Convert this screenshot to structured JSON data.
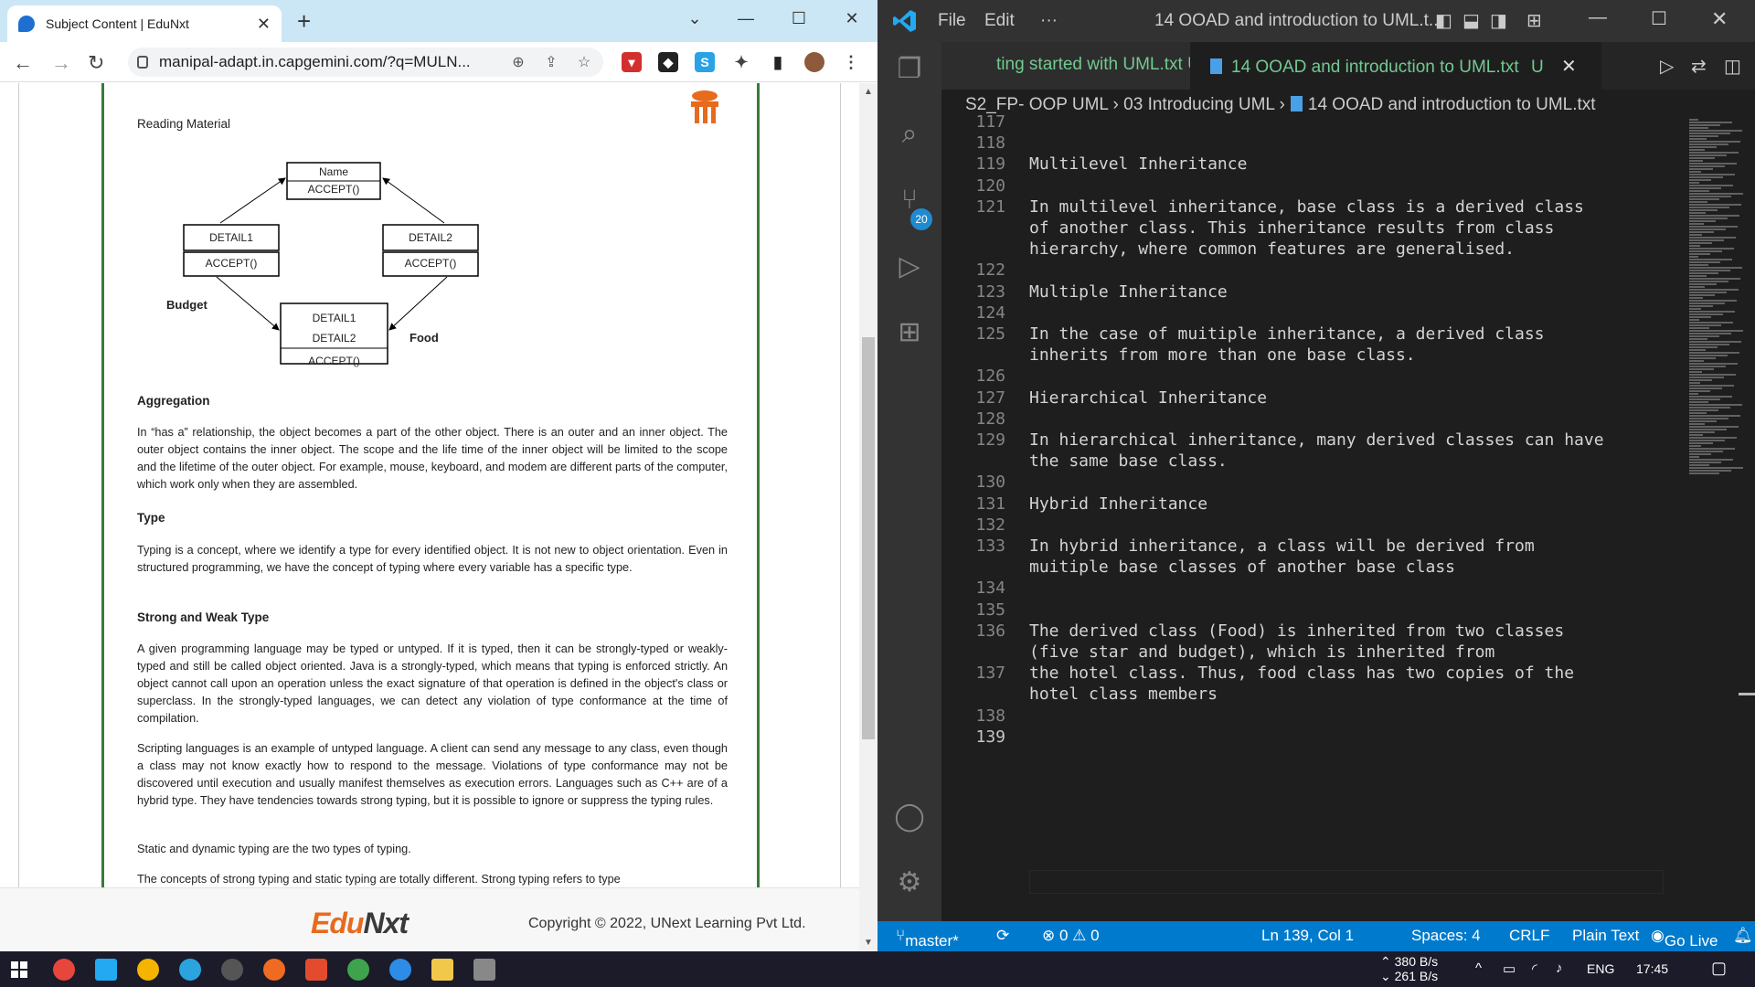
{
  "chrome": {
    "tab_title": "Subject Content | EduNxt",
    "url": "manipal-adapt.in.capgemini.com/?q=MULN...",
    "window_controls": {
      "minimize": "—",
      "maximize": "☐",
      "close": "✕",
      "dropdown": "⌄"
    }
  },
  "document": {
    "section_label": "Reading Material",
    "diagram": {
      "name_box": [
        "Name",
        "ACCEPT()"
      ],
      "detail1_box": [
        "DETAIL1",
        "ACCEPT()"
      ],
      "detail2_box": [
        "DETAIL2",
        "ACCEPT()"
      ],
      "bottom_box": [
        "DETAIL1",
        "DETAIL2",
        "ACCEPT()"
      ],
      "budget_label": "Budget",
      "food_label": "Food"
    },
    "aggregation_heading": "Aggregation",
    "aggregation_text": "In “has a” relationship, the object becomes a part of the other object. There is an outer and an inner object. The outer object contains the inner object. The scope and the life time of the inner object will be limited to the scope and the lifetime of the outer object. For example, mouse, keyboard, and modem are different parts of the computer, which work only when they are assembled.",
    "type_heading": "Type",
    "type_text": "Typing is a concept, where we identify a type for every identified object. It is not new to object orientation. Even in structured programming, we have the concept of typing where every variable has a specific type.",
    "strong_weak_heading": "Strong and Weak Type",
    "strong_weak_text": "A given programming language may be typed or untyped. If it is typed, then it can be strongly-typed or weakly-typed and still be called object oriented. Java is a strongly-typed, which means that typing is enforced strictly. An object cannot call upon an operation unless the exact signature of that operation is defined in the object's class or superclass. In the strongly-typed languages, we can detect any violation of type conformance at the time of compilation.",
    "scripting_text": "Scripting languages is an example of untyped language. A client can send any message to any class, even though a class may not know exactly how to respond to the message. Violations of type conformance may not be discovered until execution and usually manifest themselves as execution errors. Languages such as C++ are of a hybrid type. They have tendencies towards strong typing, but it is possible to ignore or suppress the typing rules.",
    "static_dynamic_text": "Static and dynamic typing are the two types of typing.",
    "concepts_text": "The concepts of strong typing and static typing are totally different. Strong typing refers to type"
  },
  "footer": {
    "brand_edu": "Edu",
    "brand_next": "Nxt",
    "copyright": "Copyright © 2022, UNext Learning Pvt Ltd."
  },
  "vscode": {
    "menu": [
      "File",
      "Edit",
      "···"
    ],
    "title": "14 OOAD and introduction to UML.t...",
    "tab1": "ting started with UML.txt  U",
    "tab2": "14 OOAD and introduction to UML.txt",
    "tab2_status": "U",
    "breadcrumb": "S2_FP- OOP UML  ›  03 Introducing UML  ›",
    "breadcrumb_file": "14 OOAD and introduction to UML.txt",
    "badge": "20",
    "lines": [
      {
        "n": "117",
        "t": ""
      },
      {
        "n": "118",
        "t": ""
      },
      {
        "n": "119",
        "t": "Multilevel Inheritance"
      },
      {
        "n": "120",
        "t": ""
      },
      {
        "n": "121",
        "t": "In multilevel inheritance, base class is a derived class"
      },
      {
        "n": "",
        "t": "of another class. This inheritance results from class"
      },
      {
        "n": "",
        "t": "hierarchy, where common features are generalised."
      },
      {
        "n": "122",
        "t": ""
      },
      {
        "n": "123",
        "t": "Multiple Inheritance"
      },
      {
        "n": "124",
        "t": ""
      },
      {
        "n": "125",
        "t": "In the case of muitiple inheritance, a derived class"
      },
      {
        "n": "",
        "t": "inherits from more than one base class."
      },
      {
        "n": "126",
        "t": ""
      },
      {
        "n": "127",
        "t": "Hierarchical Inheritance"
      },
      {
        "n": "128",
        "t": ""
      },
      {
        "n": "129",
        "t": "In hierarchical inheritance, many derived classes can have"
      },
      {
        "n": "",
        "t": "the same base class."
      },
      {
        "n": "130",
        "t": ""
      },
      {
        "n": "131",
        "t": "Hybrid Inheritance"
      },
      {
        "n": "132",
        "t": ""
      },
      {
        "n": "133",
        "t": "In hybrid inheritance, a class will be derived from"
      },
      {
        "n": "",
        "t": "muitiple base classes of another base class"
      },
      {
        "n": "134",
        "t": ""
      },
      {
        "n": "135",
        "t": ""
      },
      {
        "n": "136",
        "t": "The derived class (Food) is inherited from two classes"
      },
      {
        "n": "",
        "t": "(five star and budget), which is inherited from"
      },
      {
        "n": "137",
        "t": "the hotel class. Thus, food class has two copies of the"
      },
      {
        "n": "",
        "t": "hotel class members"
      },
      {
        "n": "138",
        "t": ""
      },
      {
        "n": "139",
        "t": ""
      }
    ],
    "status": {
      "branch": "master*",
      "errors": "⊗ 0 ⚠ 0",
      "position": "Ln 139, Col 1",
      "spaces": "Spaces: 4",
      "eol": "CRLF",
      "language": "Plain Text",
      "golive": "Go Live"
    }
  },
  "taskbar": {
    "net_up": "380 B/s",
    "net_down": "261 B/s",
    "lang": "ENG",
    "time": "17:45"
  }
}
